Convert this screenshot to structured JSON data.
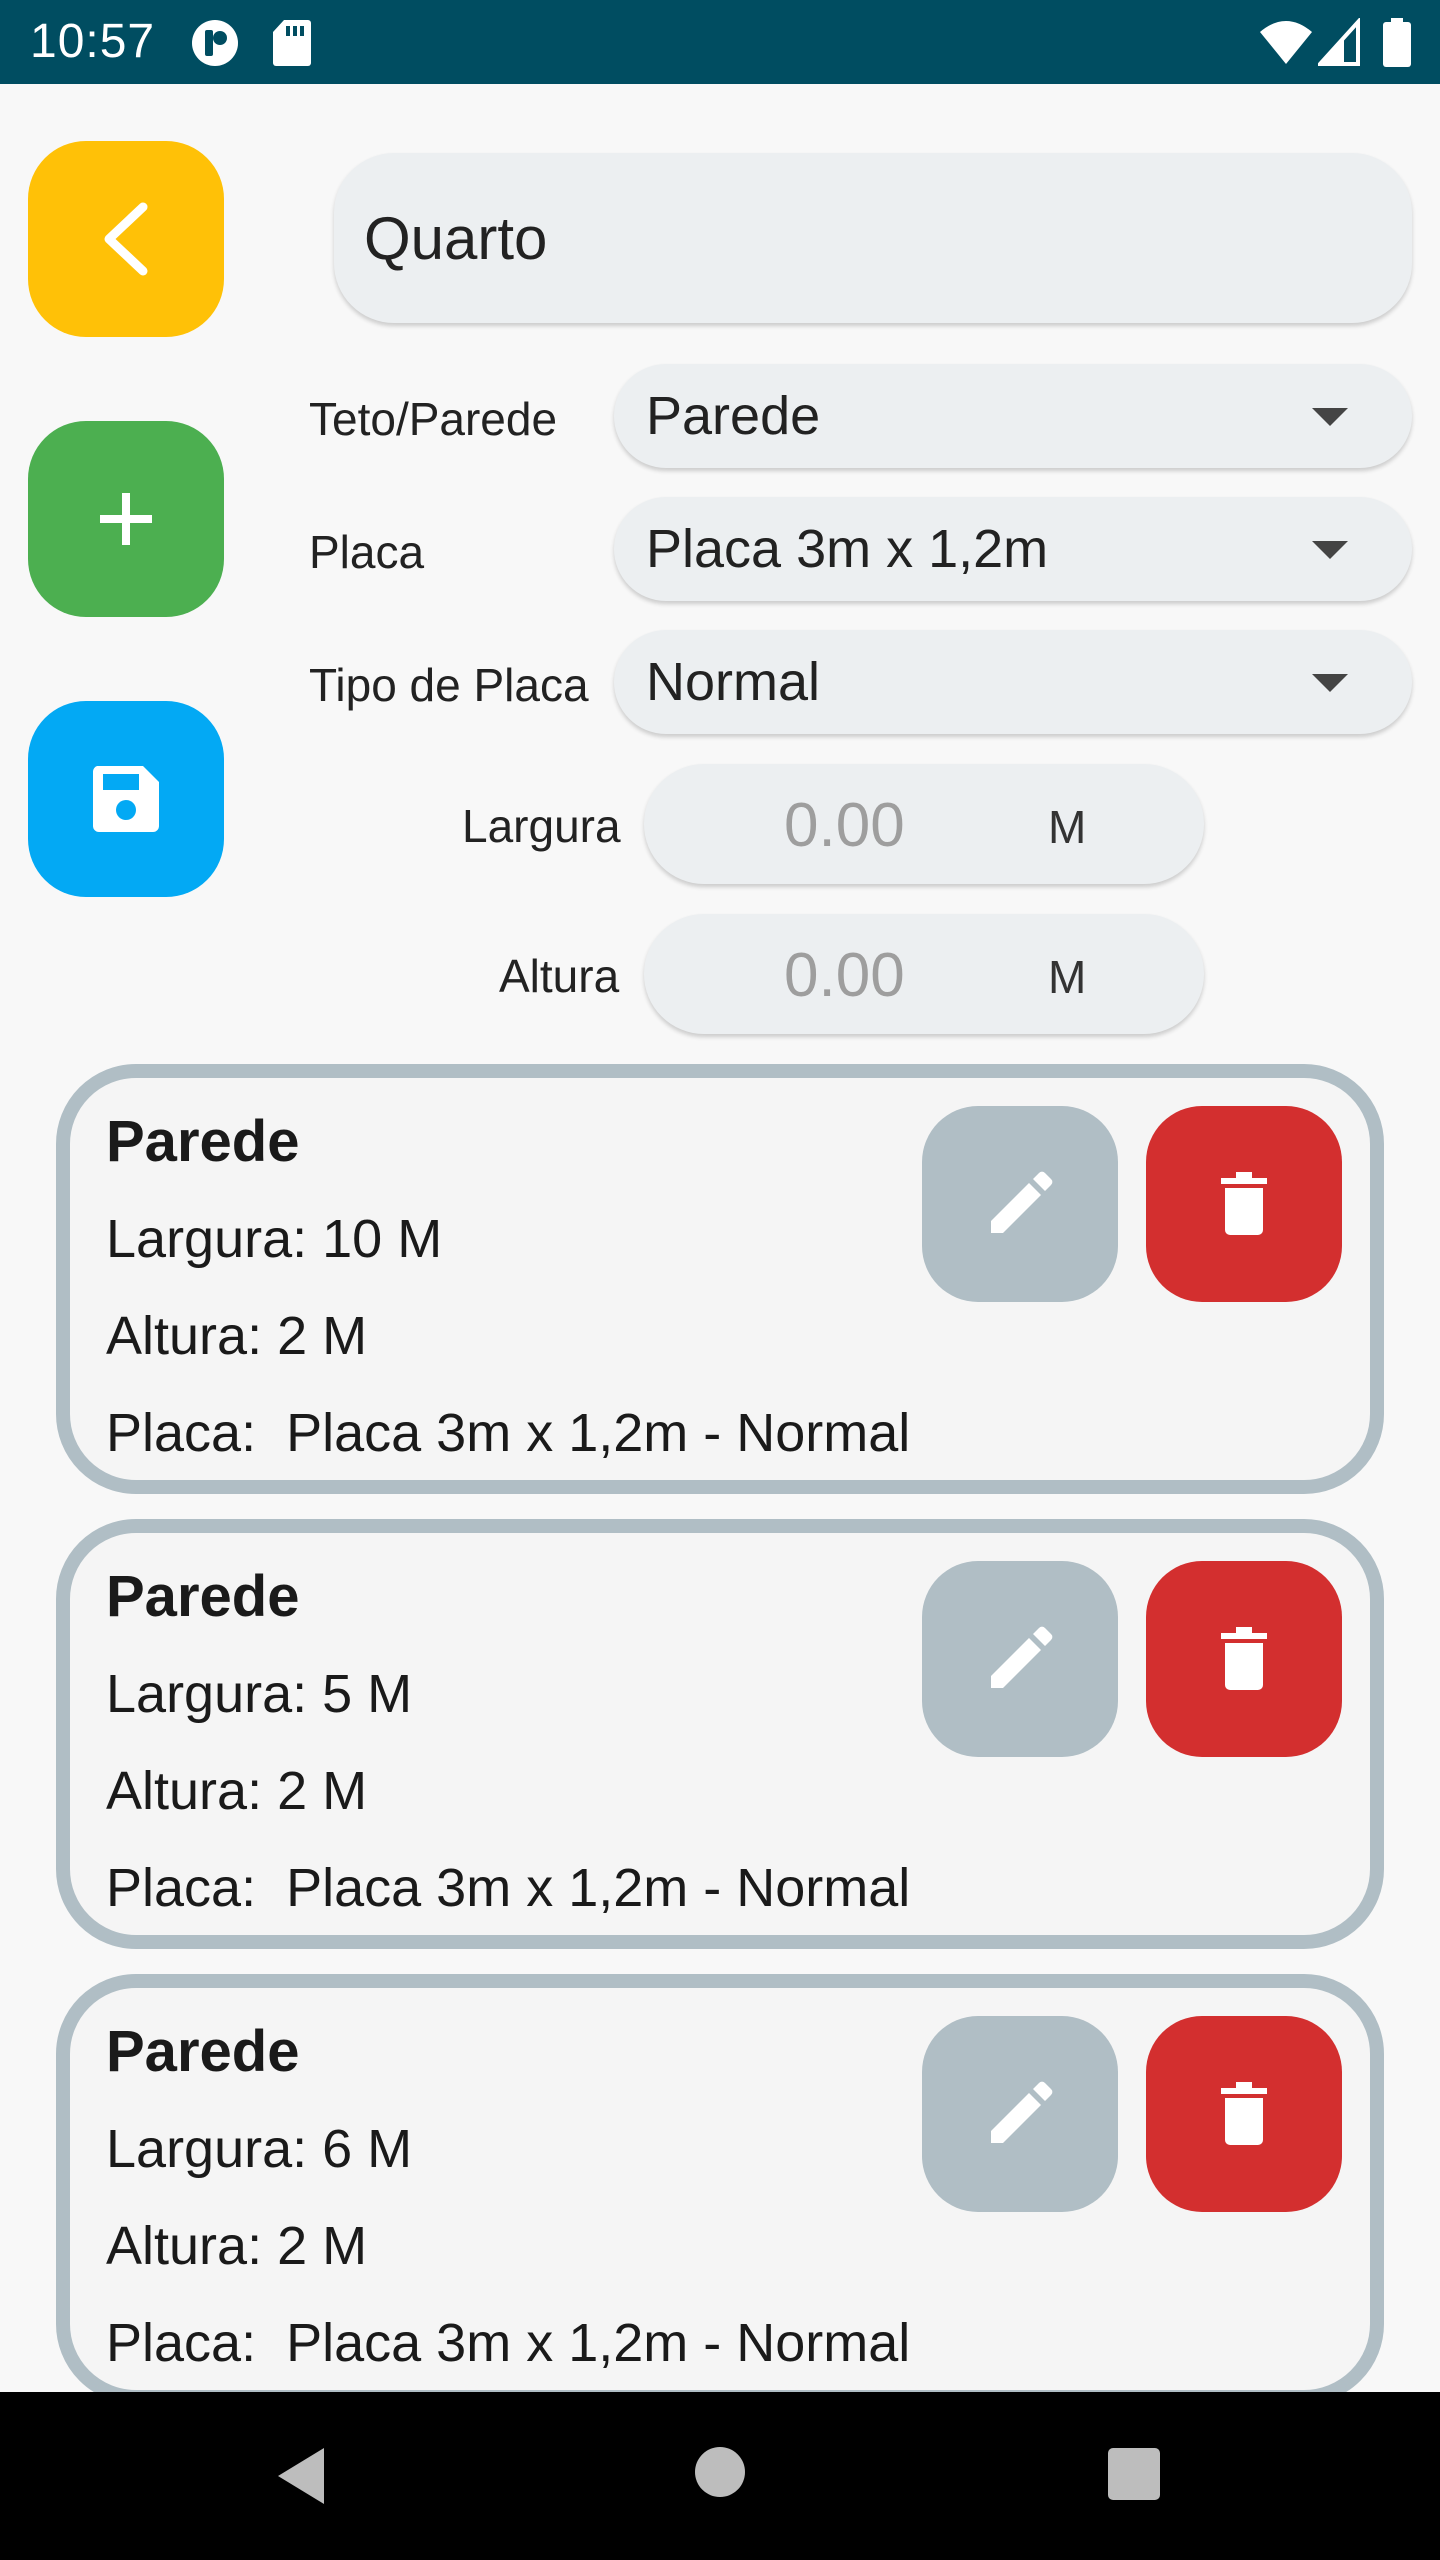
{
  "status_bar": {
    "time": "10:57"
  },
  "room": {
    "name": "Quarto"
  },
  "actions": {
    "back_icon": "chevron-left-icon",
    "add_icon": "plus-icon",
    "save_icon": "floppy-disk-icon"
  },
  "form": {
    "type_label": "Teto/Parede",
    "type_value": "Parede",
    "board_label": "Placa",
    "board_value": "Placa 3m x 1,2m",
    "board_type_label": "Tipo de Placa",
    "board_type_value": "Normal",
    "width_label": "Largura",
    "width_placeholder": "0.00",
    "width_unit": "M",
    "height_label": "Altura",
    "height_placeholder": "0.00",
    "height_unit": "M"
  },
  "items": [
    {
      "title": "Parede",
      "width": "Largura: 10 M",
      "height": "Altura: 2 M",
      "board": "Placa:  Placa 3m x 1,2m - Normal"
    },
    {
      "title": "Parede",
      "width": "Largura: 5 M",
      "height": "Altura: 2 M",
      "board": "Placa:  Placa 3m x 1,2m - Normal"
    },
    {
      "title": "Parede",
      "width": "Largura: 6 M",
      "height": "Altura: 2 M",
      "board": "Placa:  Placa 3m x 1,2m - Normal"
    }
  ],
  "colors": {
    "status_bar": "#004d61",
    "back": "#ffc107",
    "add": "#4caf50",
    "save": "#03a9f4",
    "edit": "#b0bec5",
    "delete": "#d32f2f"
  }
}
